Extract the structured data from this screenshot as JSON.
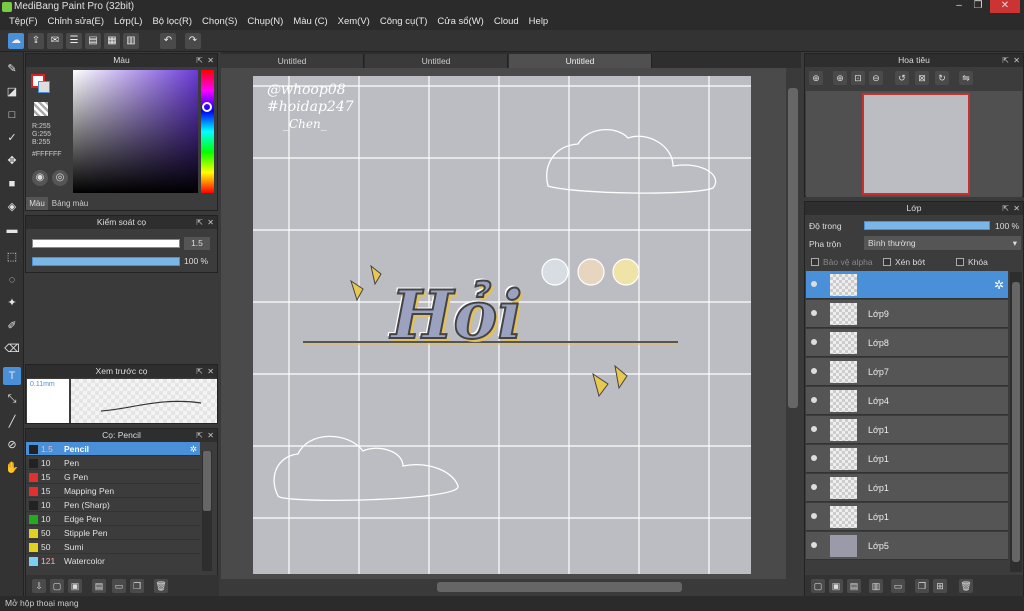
{
  "app": {
    "title": "MediBang Paint Pro (32bit)"
  },
  "menu": [
    "Tệp(F)",
    "Chỉnh sửa(E)",
    "Lớp(L)",
    "Bộ lọc(R)",
    "Chọn(S)",
    "Chụp(N)",
    "Màu (C)",
    "Xem(V)",
    "Công cụ(T)",
    "Cửa sổ(W)",
    "Cloud",
    "Help"
  ],
  "tabs": [
    "Untitled",
    "Untitled",
    "Untitled"
  ],
  "color_panel": {
    "title": "Màu",
    "r": "R:255",
    "g": "G:255",
    "b": "B:255",
    "hex": "#FFFFFF",
    "tab_color": "Màu",
    "tab_palette": "Bảng màu"
  },
  "brush_control": {
    "title": "Kiểm soát cọ",
    "size": "1.5",
    "opacity": "100 %"
  },
  "brush_preview": {
    "title": "Xem trước cọ",
    "size_label": "0.11mm"
  },
  "brush_list": {
    "title": "Cọ: Pencil",
    "items": [
      {
        "size": "1.5",
        "name": "Pencil",
        "color": "#222222"
      },
      {
        "size": "10",
        "name": "Pen",
        "color": "#222222"
      },
      {
        "size": "15",
        "name": "G Pen",
        "color": "#e03030"
      },
      {
        "size": "15",
        "name": "Mapping Pen",
        "color": "#e03030"
      },
      {
        "size": "10",
        "name": "Pen (Sharp)",
        "color": "#222222"
      },
      {
        "size": "10",
        "name": "Edge Pen",
        "color": "#22aa22"
      },
      {
        "size": "50",
        "name": "Stipple Pen",
        "color": "#e0d020"
      },
      {
        "size": "50",
        "name": "Sumi",
        "color": "#e0d020"
      },
      {
        "size": "121",
        "name": "Watercolor",
        "color": "#7ad0f0"
      }
    ]
  },
  "navigator": {
    "title": "Hoa tiêu"
  },
  "layer_panel": {
    "title": "Lớp",
    "opacity_label": "Độ trong",
    "opacity_value": "100 %",
    "blend_label": "Pha trộn",
    "blend_value": "Bình thường",
    "protect_alpha": "Bảo vệ alpha",
    "clipping": "Xén bớt",
    "lock": "Khóa",
    "layers": [
      "",
      "Lớp9",
      "Lớp8",
      "Lớp7",
      "Lớp4",
      "Lớp1",
      "Lớp1",
      "Lớp1",
      "Lớp1",
      "Lớp5"
    ]
  },
  "canvas_text": {
    "watermark1": "@whoop08",
    "watermark2": "#hoidap247",
    "watermark3": "_Chen_",
    "title_art": "Hỏi"
  },
  "status": "Mở hộp thoại mạng",
  "colors": {
    "accent": "#4a90d9",
    "canvas": "#bbbdc2",
    "bg": "#3a3a3a"
  }
}
